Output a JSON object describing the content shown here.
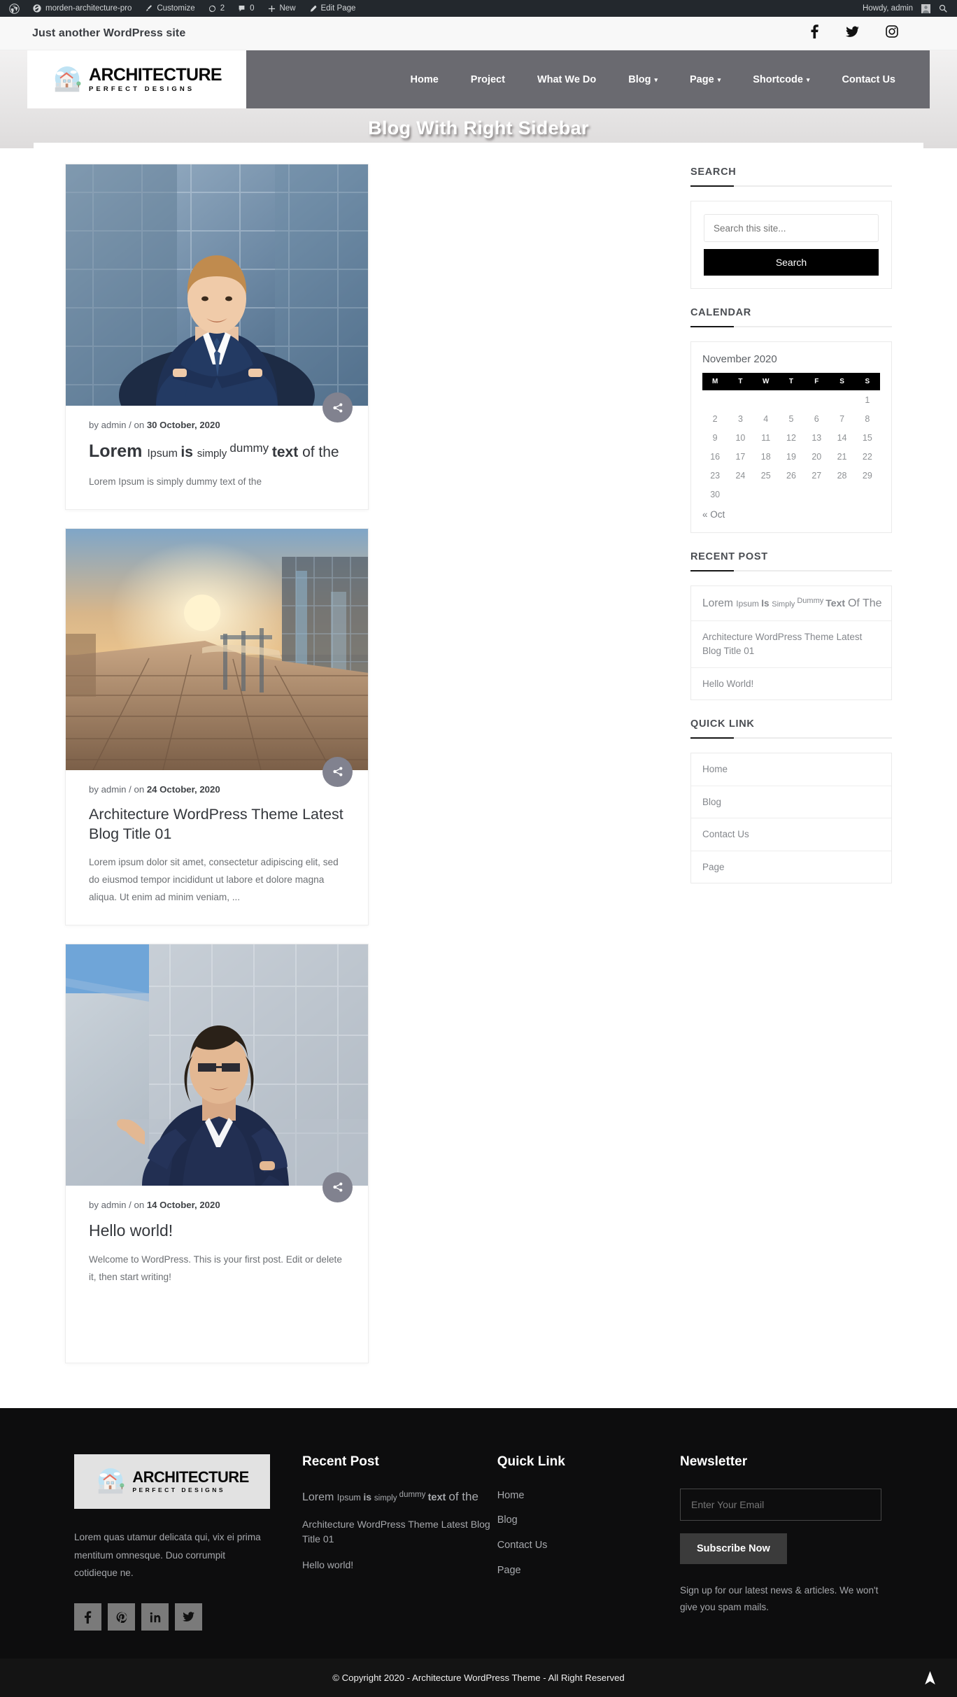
{
  "adminbar": {
    "site_name": "morden-architecture-pro",
    "customize": "Customize",
    "updates_count": "2",
    "comments_count": "0",
    "new": "New",
    "edit_page": "Edit Page",
    "howdy": "Howdy, admin"
  },
  "topbar": {
    "tagline": "Just another WordPress site",
    "social": [
      "facebook-icon",
      "twitter-icon",
      "instagram-icon"
    ]
  },
  "logo": {
    "line1": "ARCHITECTURE",
    "line2": "PERFECT DESIGNS"
  },
  "nav": {
    "items": [
      {
        "label": "Home",
        "has_dropdown": false
      },
      {
        "label": "Project",
        "has_dropdown": false
      },
      {
        "label": "What We Do",
        "has_dropdown": false
      },
      {
        "label": "Blog",
        "has_dropdown": true
      },
      {
        "label": "Page",
        "has_dropdown": true
      },
      {
        "label": "Shortcode",
        "has_dropdown": true
      },
      {
        "label": "Contact Us",
        "has_dropdown": false
      }
    ]
  },
  "page": {
    "title": "Blog With Right Sidebar"
  },
  "posts": [
    {
      "author_prefix": "by admin / on ",
      "date": "30 October, 2020",
      "title_parts": [
        {
          "text": "Lorem ",
          "style": "a"
        },
        {
          "text": "Ipsum ",
          "style": "b"
        },
        {
          "text": "is ",
          "style": "c"
        },
        {
          "text": "simply ",
          "style": "d"
        },
        {
          "text": "dummy ",
          "style": "e"
        },
        {
          "text": "text ",
          "style": "f"
        },
        {
          "text": "of the",
          "style": "g"
        }
      ],
      "title_plain": "Lorem Ipsum is simply dummy text of the",
      "excerpt": "Lorem Ipsum is simply dummy text of the",
      "image": "businessman-portrait",
      "share_icon": "share-icon"
    },
    {
      "author_prefix": "by admin / on ",
      "date": "24 October, 2020",
      "title_plain": "Architecture WordPress Theme Latest Blog Title 01",
      "excerpt": "Lorem ipsum dolor sit amet, consectetur adipiscing elit, sed do eiusmod tempor incididunt ut labore et dolore magna aliqua. Ut enim ad minim veniam, ...",
      "image": "sunset-boardwalk",
      "share_icon": "share-icon"
    },
    {
      "author_prefix": "by admin / on ",
      "date": "14 October, 2020",
      "title_plain": "Hello world!",
      "excerpt": "Welcome to WordPress. This is your first post. Edit or delete it, then start writing!",
      "image": "businesswoman-portrait",
      "share_icon": "share-icon"
    }
  ],
  "sidebar": {
    "search": {
      "title": "SEARCH",
      "placeholder": "Search this site...",
      "value": "",
      "button": "Search"
    },
    "calendar": {
      "title": "CALENDAR",
      "caption": "November 2020",
      "daynames": [
        "M",
        "T",
        "W",
        "T",
        "F",
        "S",
        "S"
      ],
      "weeks": [
        [
          "",
          "",
          "",
          "",
          "",
          "",
          "1"
        ],
        [
          "2",
          "3",
          "4",
          "5",
          "6",
          "7",
          "8"
        ],
        [
          "9",
          "10",
          "11",
          "12",
          "13",
          "14",
          "15"
        ],
        [
          "16",
          "17",
          "18",
          "19",
          "20",
          "21",
          "22"
        ],
        [
          "23",
          "24",
          "25",
          "26",
          "27",
          "28",
          "29"
        ],
        [
          "30",
          "",
          "",
          "",
          "",
          "",
          ""
        ]
      ],
      "prev": "« Oct"
    },
    "recent_post": {
      "title": "RECENT POST",
      "items": [
        {
          "plain": "Lorem Ipsum Is Simply Dummy Text Of The",
          "parts": [
            {
              "text": "Lorem ",
              "style": "a"
            },
            {
              "text": "Ipsum ",
              "style": "b"
            },
            {
              "text": "Is ",
              "style": "c"
            },
            {
              "text": "Simply ",
              "style": "d"
            },
            {
              "text": "Dummy ",
              "style": "e"
            },
            {
              "text": "Text ",
              "style": "f"
            },
            {
              "text": "Of The",
              "style": "g"
            }
          ]
        },
        {
          "plain": "Architecture WordPress Theme Latest Blog Title 01"
        },
        {
          "plain": "Hello World!"
        }
      ]
    },
    "quick_link": {
      "title": "QUICK LINK",
      "items": [
        "Home",
        "Blog",
        "Contact Us",
        "Page"
      ]
    }
  },
  "footer": {
    "about": "Lorem quas utamur delicata qui, vix ei prima mentitum omnesque. Duo corrumpit cotidieque ne.",
    "social": [
      "facebook-icon",
      "pinterest-icon",
      "linkedin-icon",
      "twitter-icon"
    ],
    "recent_post": {
      "title": "Recent Post",
      "items": [
        {
          "plain": "Lorem Ipsum is simply dummy text of the",
          "parts": [
            {
              "text": "Lorem ",
              "style": "a"
            },
            {
              "text": "Ipsum ",
              "style": "b"
            },
            {
              "text": "is ",
              "style": "c"
            },
            {
              "text": "simply ",
              "style": "d"
            },
            {
              "text": "dummy ",
              "style": "e"
            },
            {
              "text": "text ",
              "style": "f"
            },
            {
              "text": "of the",
              "style": "g"
            }
          ]
        },
        {
          "plain": "Architecture WordPress Theme Latest Blog Title 01"
        },
        {
          "plain": "Hello world!"
        }
      ]
    },
    "quick_link": {
      "title": "Quick Link",
      "items": [
        "Home",
        "Blog",
        "Contact Us",
        "Page"
      ]
    },
    "newsletter": {
      "title": "Newsletter",
      "placeholder": "Enter Your Email",
      "value": "",
      "button": "Subscribe Now",
      "note": "Sign up for our latest news & articles. We won't give you spam mails."
    },
    "copyright": "© Copyright 2020 - Architecture WordPress Theme - All Right Reserved",
    "to_top_icon": "scroll-to-top-icon"
  },
  "colors": {
    "admin_bar": "#23282d",
    "nav_bg": "#6a6a70",
    "accent_dark": "#000000",
    "footer_bg": "#0d0d0e",
    "copyright_bg": "#141414",
    "share_btn": "#81828f"
  }
}
